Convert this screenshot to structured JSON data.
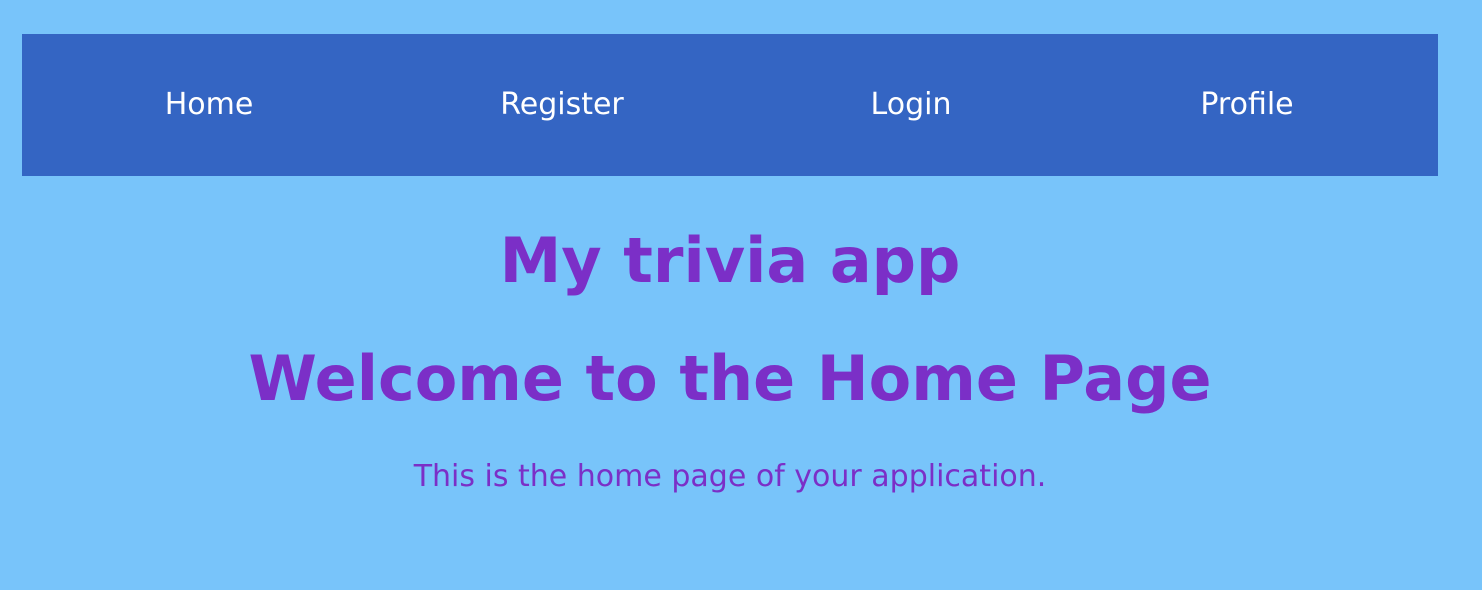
{
  "nav": {
    "items": [
      {
        "label": "Home"
      },
      {
        "label": "Register"
      },
      {
        "label": "Login"
      },
      {
        "label": "Profile"
      }
    ]
  },
  "main": {
    "app_title": "My trivia app",
    "heading": "Welcome to the Home Page",
    "description": "This is the home page of your application."
  },
  "colors": {
    "background": "#78c4fa",
    "nav_background": "#3465c3",
    "nav_text": "#ffffff",
    "heading_text": "#7b2fc7"
  }
}
